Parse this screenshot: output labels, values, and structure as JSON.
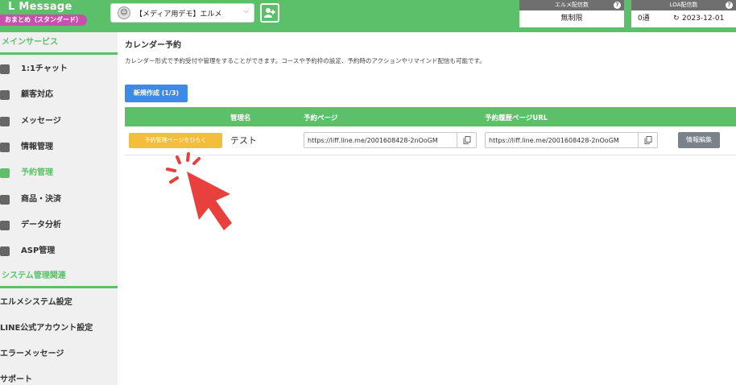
{
  "header": {
    "logo": "L Message",
    "plan": "おまとめ（スタンダード）",
    "account_name": "【メディア用デモ】エルメ",
    "stat_send": {
      "label": "エルメ配信数",
      "value": "無制限"
    },
    "stat_loa": {
      "label": "LOA配信数",
      "left_value": "0通",
      "right_value": "2023-12-01"
    },
    "help_glyph": "?",
    "reset_glyph": "↻"
  },
  "sidebar": {
    "main_section": "メインサービス",
    "items": [
      {
        "label": "1:1チャット"
      },
      {
        "label": "顧客対応"
      },
      {
        "label": "メッセージ"
      },
      {
        "label": "情報管理"
      },
      {
        "label": "予約管理"
      },
      {
        "label": "商品・決済"
      },
      {
        "label": "データ分析"
      },
      {
        "label": "ASP管理"
      }
    ],
    "system_section": "システム管理関連",
    "system_items": [
      {
        "label": "エルメシステム設定"
      },
      {
        "label": "LINE公式アカウント設定"
      },
      {
        "label": "エラーメッセージ"
      },
      {
        "label": "サポート"
      }
    ]
  },
  "main": {
    "title": "カレンダー予約",
    "description": "カレンダー形式で予約受付や管理をすることができます。コースや予約枠の設定、予約時のアクションやリマインド配信も可能です。",
    "new_button": "新規作成 (1/3)",
    "table": {
      "col_name": "管理名",
      "col_booking": "予約ページ",
      "col_history": "予約履歴ページURL",
      "row": {
        "open_button": "予約管理ページをひらく",
        "name": "テスト",
        "booking_url": "https://liff.line.me/2001608428-2nOoGM",
        "history_url": "https://liff.line.me/2001608428-2nOoGM",
        "edit_button": "情報編集"
      }
    }
  },
  "colors": {
    "brand_green": "#5cbf6a",
    "plan_pink": "#c94fae",
    "primary_blue": "#3c8be8",
    "open_yellow": "#f3be3b",
    "edit_gray": "#7b8189",
    "cursor_red": "#e8403c"
  }
}
